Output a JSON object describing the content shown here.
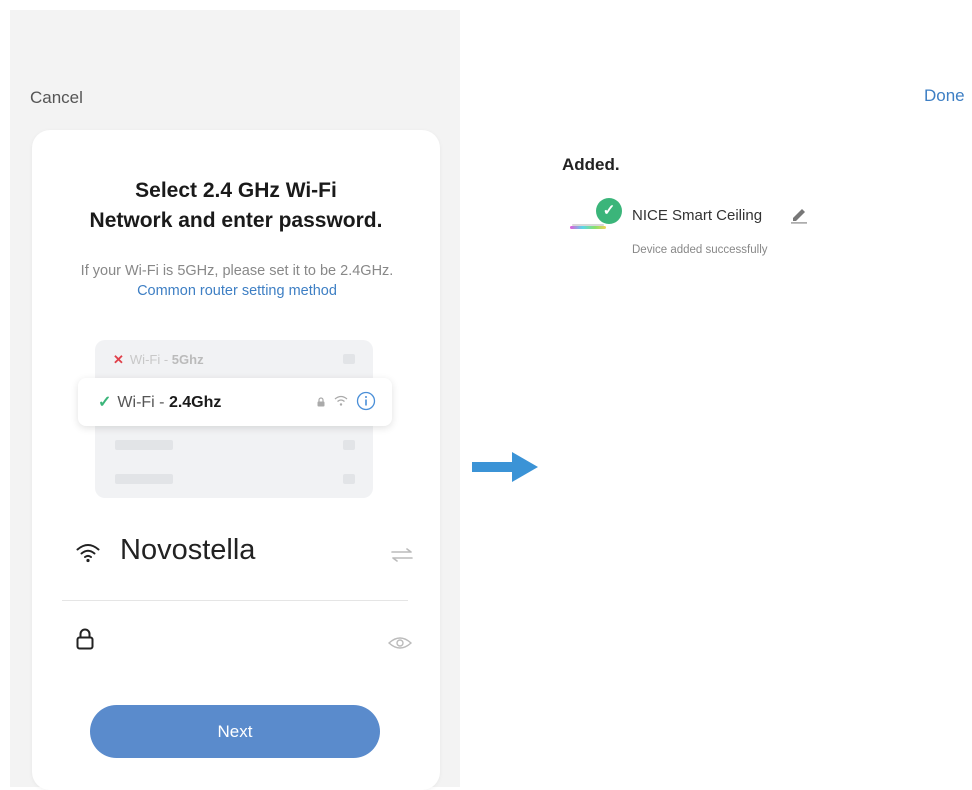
{
  "left": {
    "cancel_label": "Cancel",
    "title_line1": "Select 2.4 GHz Wi-Fi",
    "title_line2": "Network and enter password.",
    "subtitle": "If your Wi-Fi is 5GHz, please set it to be 2.4GHz. ",
    "subtitle_link": "Common router setting method",
    "illustration": {
      "wifi_5_prefix": "Wi-Fi - ",
      "wifi_5_band": "5Ghz",
      "wifi_24_prefix": "Wi-Fi - ",
      "wifi_24_band": "2.4Ghz"
    },
    "ssid": "Novostella",
    "password_value": "",
    "next_label": "Next"
  },
  "right": {
    "done_label": "Done",
    "added_label": "Added.",
    "device_name": "NICE Smart Ceiling",
    "device_status": "Device added successfully"
  },
  "colors": {
    "accent": "#5a8bcc",
    "link": "#3e7fc4",
    "success": "#3bb57a",
    "error": "#e0404a"
  }
}
